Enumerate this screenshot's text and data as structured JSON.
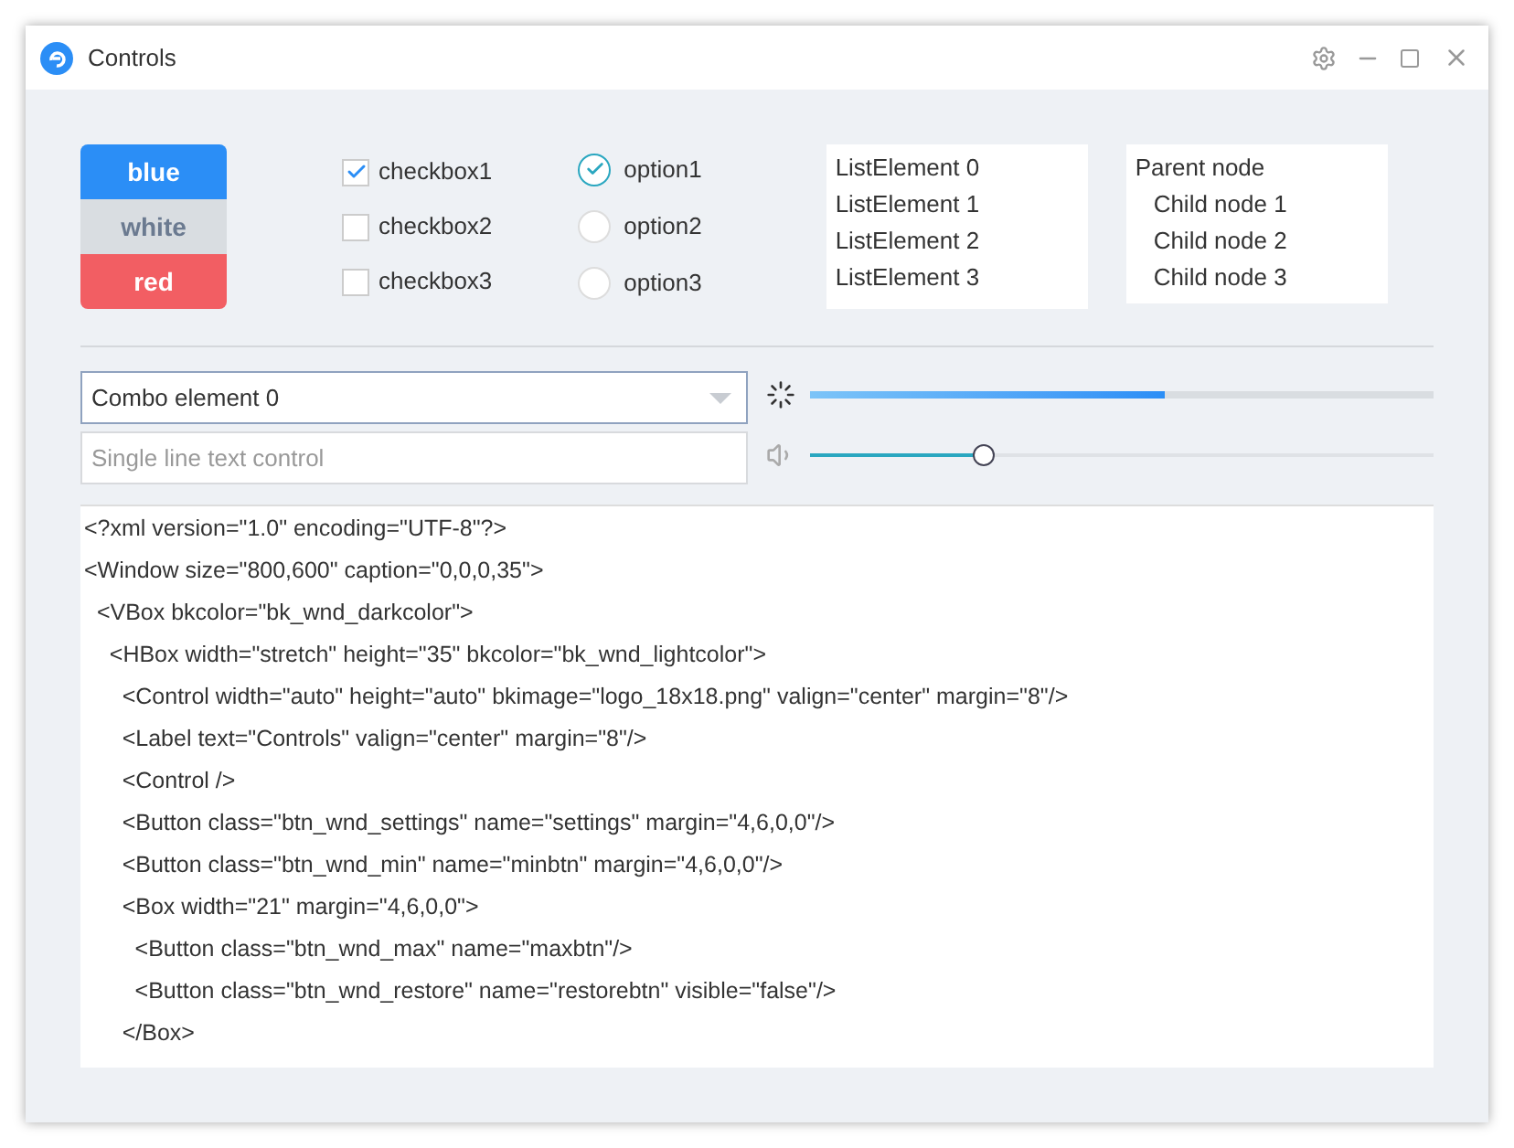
{
  "window": {
    "title": "Controls"
  },
  "buttons": [
    {
      "label": "blue",
      "kind": "blue"
    },
    {
      "label": "white",
      "kind": "white"
    },
    {
      "label": "red",
      "kind": "red"
    }
  ],
  "checkboxes": [
    {
      "label": "checkbox1",
      "checked": true
    },
    {
      "label": "checkbox2",
      "checked": false
    },
    {
      "label": "checkbox3",
      "checked": false
    }
  ],
  "radios": [
    {
      "label": "option1",
      "selected": true
    },
    {
      "label": "option2",
      "selected": false
    },
    {
      "label": "option3",
      "selected": false
    }
  ],
  "list": {
    "items": [
      "ListElement 0",
      "ListElement 1",
      "ListElement 2",
      "ListElement 3"
    ]
  },
  "tree": {
    "items": [
      {
        "label": "Parent node",
        "children": [
          {
            "label": "Child node 1"
          },
          {
            "label": "Child node 2"
          },
          {
            "label": "Child node 3"
          }
        ]
      }
    ]
  },
  "combo": {
    "value": "Combo element 0"
  },
  "text_field": {
    "placeholder": "Single line text control"
  },
  "progress": {
    "level": 0.57
  },
  "volume_slider": {
    "level": 0.28
  },
  "code_lines": [
    "<?xml version=\"1.0\" encoding=\"UTF-8\"?>",
    "<Window size=\"800,600\" caption=\"0,0,0,35\">",
    "  <VBox bkcolor=\"bk_wnd_darkcolor\">",
    "    <HBox width=\"stretch\" height=\"35\" bkcolor=\"bk_wnd_lightcolor\">",
    "      <Control width=\"auto\" height=\"auto\" bkimage=\"logo_18x18.png\" valign=\"center\" margin=\"8\"/>",
    "      <Label text=\"Controls\" valign=\"center\" margin=\"8\"/>",
    "      <Control />",
    "      <Button class=\"btn_wnd_settings\" name=\"settings\" margin=\"4,6,0,0\"/>",
    "      <Button class=\"btn_wnd_min\" name=\"minbtn\" margin=\"4,6,0,0\"/>",
    "      <Box width=\"21\" margin=\"4,6,0,0\">",
    "        <Button class=\"btn_wnd_max\" name=\"maxbtn\"/>",
    "        <Button class=\"btn_wnd_restore\" name=\"restorebtn\" visible=\"false\"/>",
    "      </Box>"
  ]
}
